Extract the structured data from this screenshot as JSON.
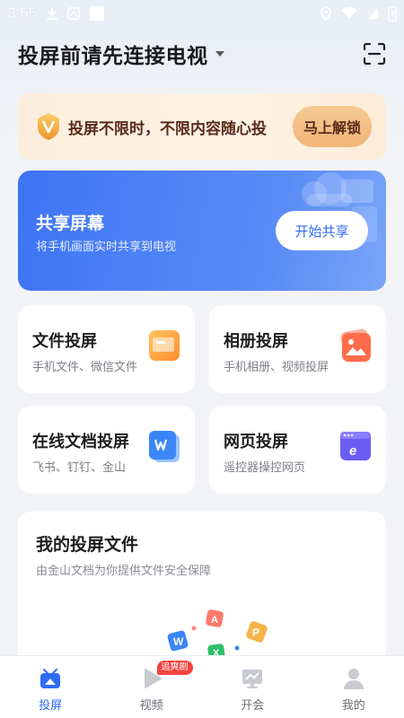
{
  "status_bar": {
    "time": "3:55"
  },
  "header": {
    "title": "投屏前请先连接电视"
  },
  "vip_banner": {
    "text": "投屏不限时，不限内容随心投",
    "button": "马上解锁"
  },
  "share_card": {
    "title": "共享屏幕",
    "subtitle": "将手机画面实时共享到电视",
    "button": "开始共享"
  },
  "features": [
    {
      "title": "文件投屏",
      "subtitle": "手机文件、微信文件",
      "icon": "folder-icon"
    },
    {
      "title": "相册投屏",
      "subtitle": "手机相册、视频投屏",
      "icon": "photo-icon"
    },
    {
      "title": "在线文档投屏",
      "subtitle": "飞书、钉钉、金山",
      "icon": "word-doc-icon"
    },
    {
      "title": "网页投屏",
      "subtitle": "遥控器操控网页",
      "icon": "browser-icon"
    }
  ],
  "my_files": {
    "title": "我的投屏文件",
    "subtitle": "由金山文档为你提供文件安全保障"
  },
  "tabs": [
    {
      "label": "投屏",
      "active": true
    },
    {
      "label": "视频",
      "badge": "追爽剧"
    },
    {
      "label": "开会"
    },
    {
      "label": "我的"
    }
  ],
  "colors": {
    "accent": "#2f6af3",
    "vip_text": "#5a2b1b",
    "badge": "#f2443f"
  }
}
